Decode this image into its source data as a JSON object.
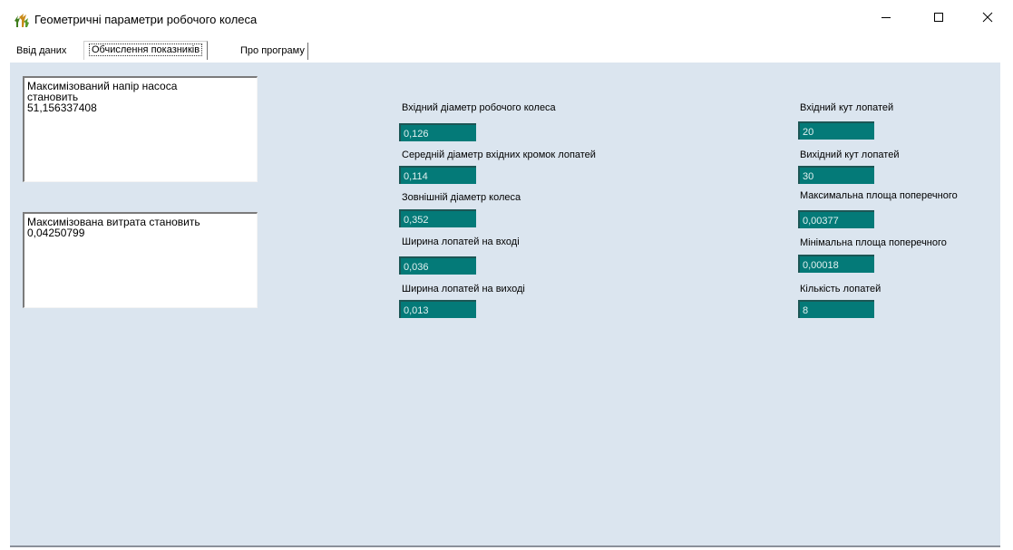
{
  "window": {
    "title": "Геометричні параметри робочого колеса",
    "icon": "app-plant-icon",
    "controls": [
      "minimize-icon",
      "maximize-icon",
      "close-icon"
    ]
  },
  "tabs": [
    {
      "label": "Ввід даних",
      "active": false
    },
    {
      "label": "Обчислення показників",
      "active": true
    },
    {
      "label": "Про програму",
      "active": false
    }
  ],
  "results": {
    "head_lines": [
      "Максимізований напір насоса",
      "становить",
      "51,156337408"
    ],
    "flow_lines": [
      "Максимізована витрата становить",
      "0,04250799"
    ]
  },
  "left_fields": [
    {
      "label": "Вхідний діаметр робочого колеса",
      "value": "0,126"
    },
    {
      "label": "Середній діаметр вхідних кромок лопатей",
      "value": "0,114"
    },
    {
      "label": "Зовнішній діаметр колеса",
      "value": "0,352"
    },
    {
      "label": "Ширина лопатей на вході",
      "value": "0,036"
    },
    {
      "label": "Ширина лопатей на виході",
      "value": "0,013"
    }
  ],
  "right_fields": [
    {
      "label": "Вхідний кут лопатей",
      "value": "20"
    },
    {
      "label": "Вихідний кут лопатей",
      "value": "30"
    },
    {
      "label": "Максимальна площа поперечного",
      "value": "0,00377"
    },
    {
      "label": "Мінімальна площа поперечного",
      "value": "0,00018"
    },
    {
      "label": "Кількість лопатей",
      "value": "8"
    }
  ],
  "colors": {
    "panel_background": "#dbe5ef",
    "field_background": "#047a78",
    "field_text": "#e2f1f1"
  }
}
